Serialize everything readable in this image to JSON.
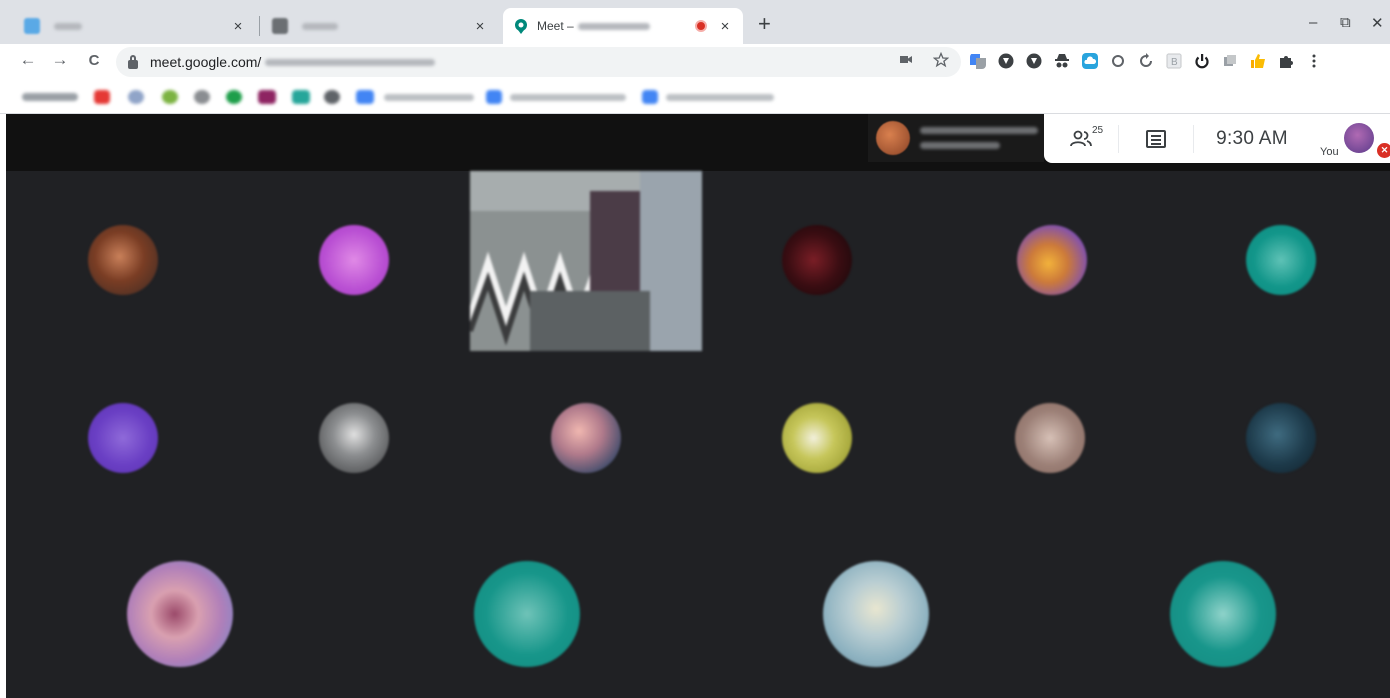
{
  "browser": {
    "tabs": [
      {
        "title": "",
        "active": false,
        "favicon_color": "#5aa9e6"
      },
      {
        "title": "",
        "active": false,
        "favicon_color": "#6b6f73"
      },
      {
        "title": "Meet – ",
        "active": true,
        "recording": true,
        "favicon_color": "#00897b"
      }
    ],
    "new_tab_label": "+",
    "close_glyph": "×",
    "window_controls": [
      "–",
      "⧉",
      "✕"
    ],
    "address": {
      "url": "meet.google.com/"
    },
    "nav": {
      "back": "←",
      "forward": "→",
      "reload": "C"
    },
    "omnibox_icons": [
      "camera-icon",
      "star-icon"
    ],
    "extensions": [
      "translate",
      "shield",
      "shield2",
      "spy",
      "cloud",
      "circle",
      "refresh",
      "b-badge",
      "power",
      "layers",
      "thumb",
      "puzzle",
      "menu"
    ]
  },
  "meet": {
    "people_count": "25",
    "clock": "9:30 AM",
    "self_label": "You",
    "accent_mic_off": "#d93025"
  },
  "participants": [
    {
      "row": 1,
      "col": 1,
      "color": "#8a5236"
    },
    {
      "row": 1,
      "col": 2,
      "color": "#b94fd3"
    },
    {
      "row": 1,
      "col": 3,
      "type": "screen-share"
    },
    {
      "row": 1,
      "col": 4,
      "color": "#3a0d12"
    },
    {
      "row": 1,
      "col": 5,
      "color": "#7d4fb5"
    },
    {
      "row": 1,
      "col": 6,
      "color": "#12968a"
    },
    {
      "row": 2,
      "col": 1,
      "color": "#6a3fc4"
    },
    {
      "row": 2,
      "col": 2,
      "color": "#77797b"
    },
    {
      "row": 2,
      "col": 3,
      "color": "#b07a8b"
    },
    {
      "row": 2,
      "col": 4,
      "color": "#a4a63a"
    },
    {
      "row": 2,
      "col": 5,
      "color": "#9c8077"
    },
    {
      "row": 2,
      "col": 6,
      "color": "#1d3a4a"
    },
    {
      "row": 3,
      "col": 1,
      "color": "#b07fb9"
    },
    {
      "row": 3,
      "col": 2,
      "color": "#17968a"
    },
    {
      "row": 3,
      "col": 3,
      "color": "#8fb3c1"
    },
    {
      "row": 3,
      "col": 4,
      "color": "#18968b"
    }
  ]
}
